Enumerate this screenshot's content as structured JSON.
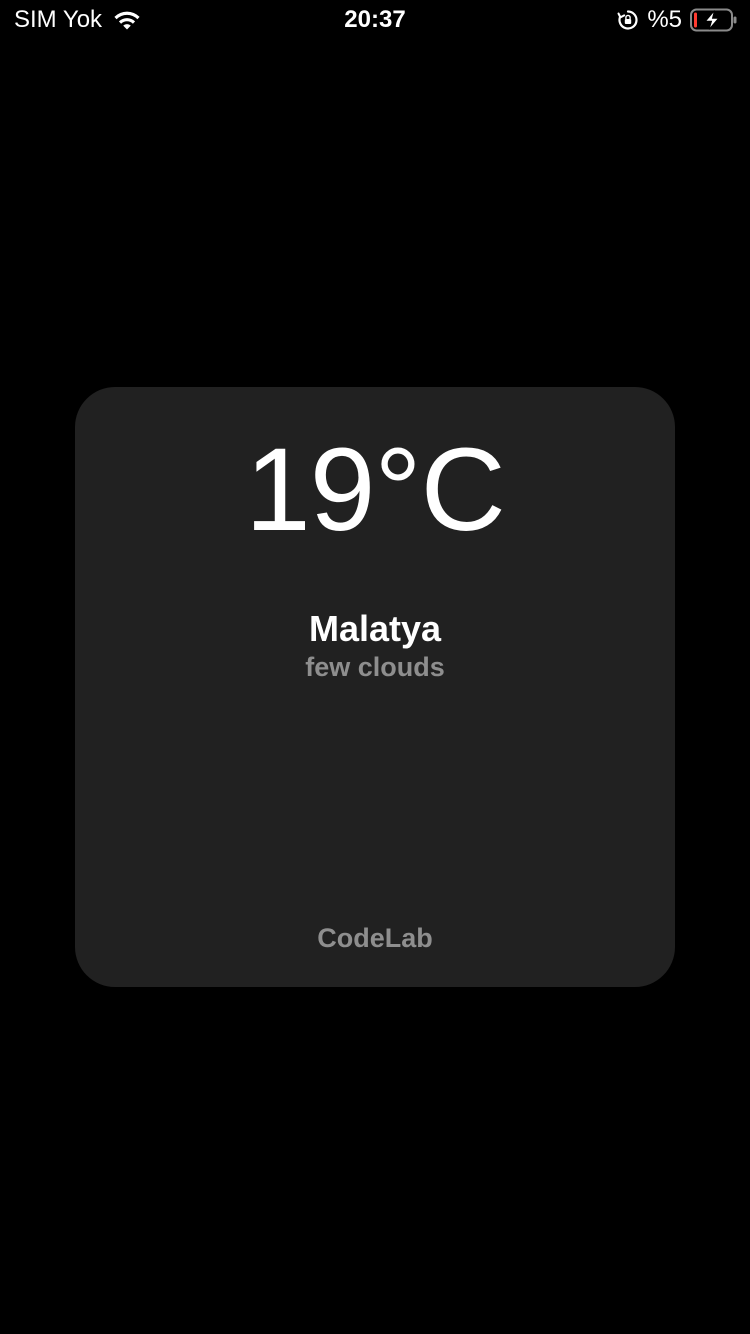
{
  "status_bar": {
    "carrier": "SIM Yok",
    "time": "20:37",
    "battery_percent": "%5",
    "wifi_icon": "wifi-icon",
    "lock_icon": "rotation-lock-icon",
    "battery_icon": "battery-charging-icon",
    "battery_level": 0.05,
    "battery_low_color": "#ff3b30"
  },
  "weather": {
    "temperature": "19°C",
    "city": "Malatya",
    "description": "few clouds"
  },
  "footer": {
    "brand": "CodeLab"
  },
  "colors": {
    "background": "#000000",
    "card": "#212121",
    "primary_text": "#ffffff",
    "secondary_text": "#8e8e8e"
  }
}
